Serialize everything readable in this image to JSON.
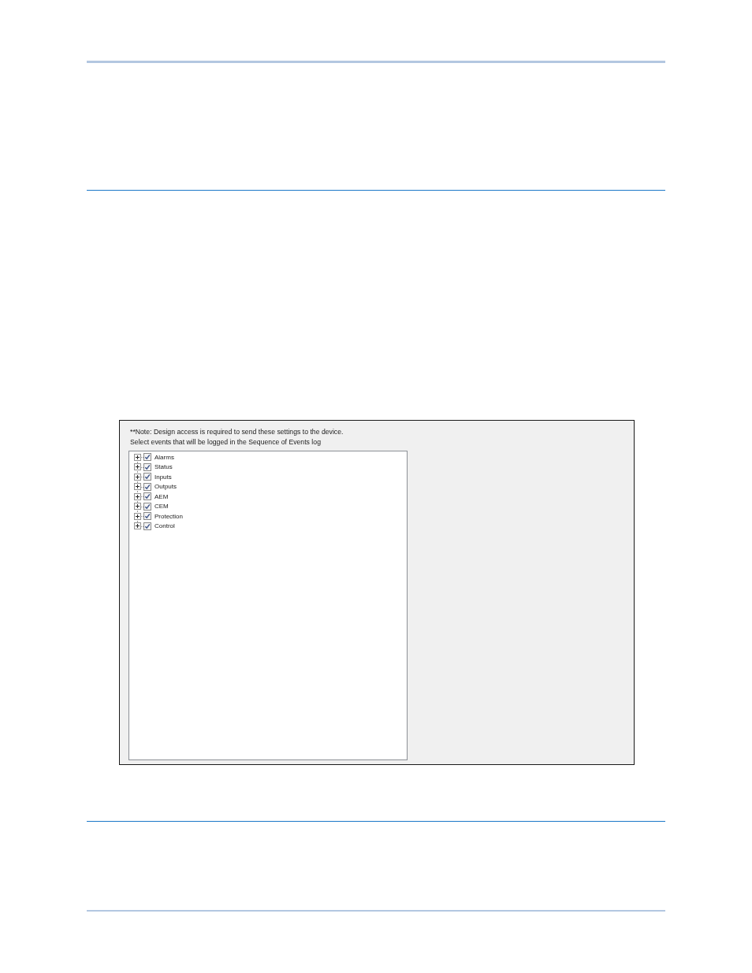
{
  "panel": {
    "note": "**Note: Design access is required to send these settings to the device.",
    "instruction": "Select events that will be logged in the Sequence of Events log",
    "tree": {
      "items": [
        {
          "label": "Alarms",
          "checked": true,
          "expanded": false
        },
        {
          "label": "Status",
          "checked": true,
          "expanded": false
        },
        {
          "label": "Inputs",
          "checked": true,
          "expanded": false
        },
        {
          "label": "Outputs",
          "checked": true,
          "expanded": false
        },
        {
          "label": "AEM",
          "checked": true,
          "expanded": false
        },
        {
          "label": "CEM",
          "checked": true,
          "expanded": false
        },
        {
          "label": "Protection",
          "checked": true,
          "expanded": false
        },
        {
          "label": "Control",
          "checked": true,
          "expanded": false
        }
      ]
    }
  }
}
